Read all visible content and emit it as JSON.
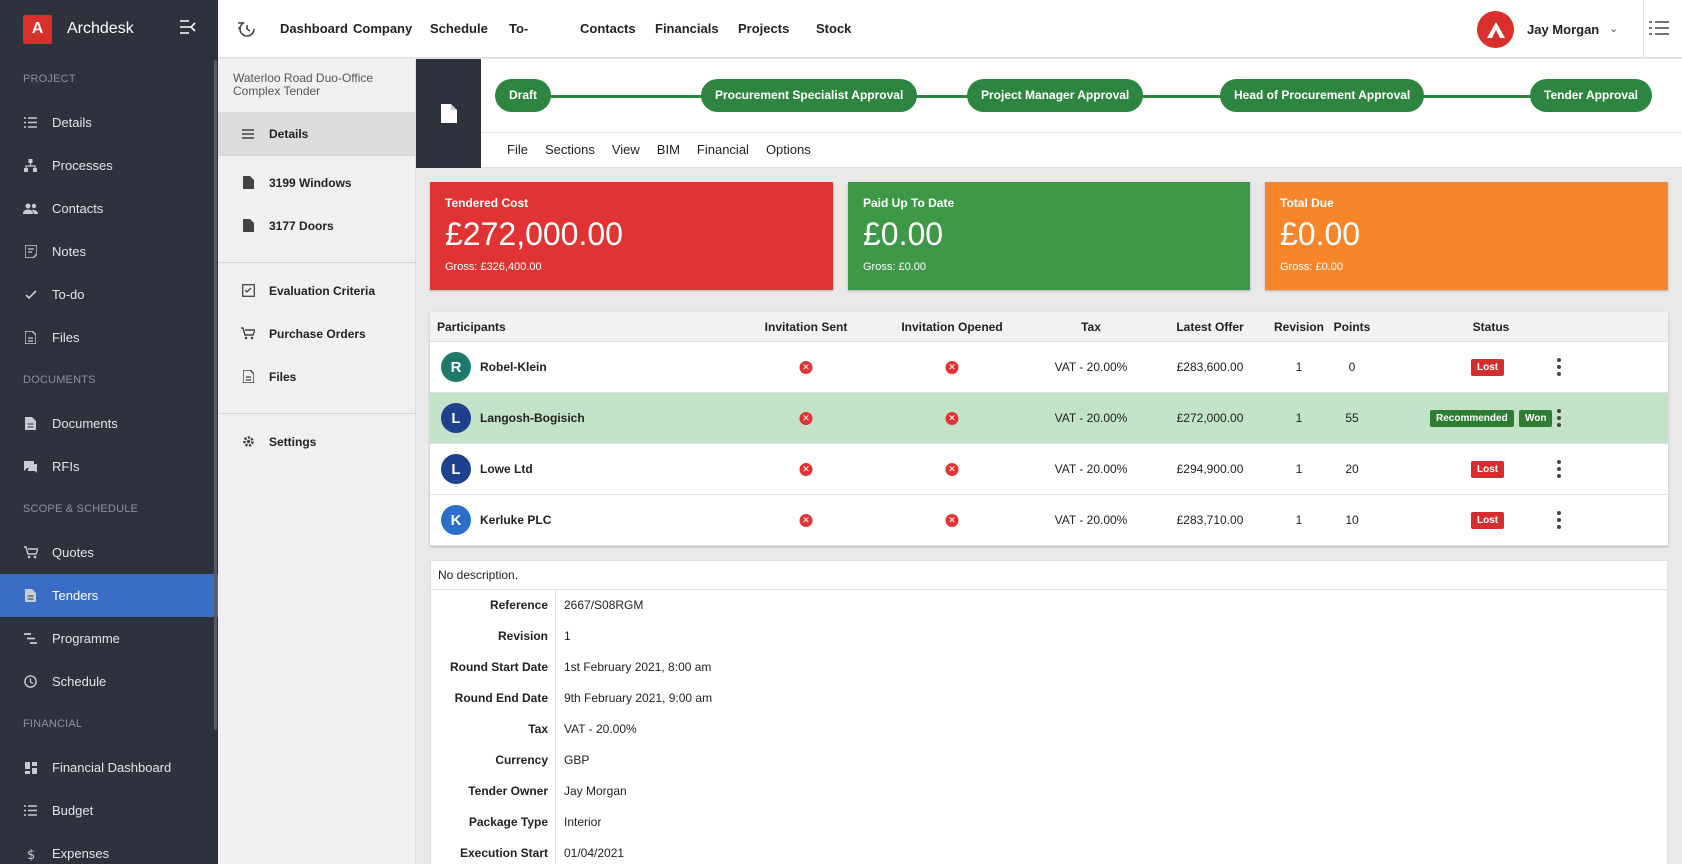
{
  "app": {
    "logo_letter": "A",
    "name": "Archdesk"
  },
  "sidebar": {
    "sections": [
      {
        "label": "PROJECT",
        "items": [
          {
            "label": "Details",
            "icon": "list-icon"
          },
          {
            "label": "Processes",
            "icon": "hierarchy-icon"
          },
          {
            "label": "Contacts",
            "icon": "people-icon"
          },
          {
            "label": "Notes",
            "icon": "note-icon"
          },
          {
            "label": "To-do",
            "icon": "check-icon"
          },
          {
            "label": "Files",
            "icon": "file-icon"
          }
        ]
      },
      {
        "label": "DOCUMENTS",
        "items": [
          {
            "label": "Documents",
            "icon": "document-icon"
          },
          {
            "label": "RFIs",
            "icon": "chat-icon"
          }
        ]
      },
      {
        "label": "SCOPE & SCHEDULE",
        "items": [
          {
            "label": "Quotes",
            "icon": "cart-icon"
          },
          {
            "label": "Tenders",
            "icon": "document-icon",
            "active": true
          },
          {
            "label": "Programme",
            "icon": "gantt-icon"
          },
          {
            "label": "Schedule",
            "icon": "clock-icon"
          }
        ]
      },
      {
        "label": "FINANCIAL",
        "items": [
          {
            "label": "Financial Dashboard",
            "icon": "dashboard-icon"
          },
          {
            "label": "Budget",
            "icon": "list-icon"
          },
          {
            "label": "Expenses",
            "icon": "dollar-icon"
          }
        ]
      }
    ]
  },
  "topnav": {
    "items": [
      "Dashboard",
      "Company",
      "Schedule",
      "To-do",
      "Contacts",
      "Financials",
      "Projects",
      "Stock"
    ],
    "user_name": "Jay Morgan"
  },
  "subnav": {
    "title": "Waterloo Road Duo-Office Complex Tender",
    "details": "Details",
    "packages": [
      "3199 Windows",
      "3177 Doors"
    ],
    "tools": [
      "Evaluation Criteria",
      "Purchase Orders",
      "Files"
    ],
    "settings": "Settings"
  },
  "workflow": {
    "steps": [
      "Draft",
      "Procurement Specialist Approval",
      "Project Manager Approval",
      "Head of Procurement Approval",
      "Tender Approval"
    ]
  },
  "menubar": {
    "items": [
      "File",
      "Sections",
      "View",
      "BIM",
      "Financial",
      "Options"
    ]
  },
  "cards": [
    {
      "label": "Tendered Cost",
      "value": "£272,000.00",
      "gross": "Gross: £326,400.00",
      "color": "#e03434"
    },
    {
      "label": "Paid Up To Date",
      "value": "£0.00",
      "gross": "Gross: £0.00",
      "color": "#3e9847"
    },
    {
      "label": "Total Due",
      "value": "£0.00",
      "gross": "Gross: £0.00",
      "color": "#f7862a"
    }
  ],
  "participants": {
    "headers": {
      "participants": "Participants",
      "invitation_sent": "Invitation Sent",
      "invitation_opened": "Invitation Opened",
      "tax": "Tax",
      "latest_offer": "Latest Offer",
      "revision": "Revision",
      "points": "Points",
      "status": "Status"
    },
    "rows": [
      {
        "initial": "R",
        "avatar_color": "#1e7a6d",
        "name": "Robel-Klein",
        "tax": "VAT - 20.00%",
        "offer": "£283,600.00",
        "revision": "1",
        "points": "0",
        "recommended": "",
        "status": "Lost"
      },
      {
        "initial": "L",
        "avatar_color": "#1f3f8f",
        "name": "Langosh-Bogisich",
        "tax": "VAT - 20.00%",
        "offer": "£272,000.00",
        "revision": "1",
        "points": "55",
        "recommended": "Recommended",
        "status": "Won"
      },
      {
        "initial": "L",
        "avatar_color": "#1f3f8f",
        "name": "Lowe Ltd",
        "tax": "VAT - 20.00%",
        "offer": "£294,900.00",
        "revision": "1",
        "points": "20",
        "recommended": "",
        "status": "Lost"
      },
      {
        "initial": "K",
        "avatar_color": "#2a6fc9",
        "name": "Kerluke PLC",
        "tax": "VAT - 20.00%",
        "offer": "£283,710.00",
        "revision": "1",
        "points": "10",
        "recommended": "",
        "status": "Lost"
      }
    ]
  },
  "details": {
    "description": "No description.",
    "fields": [
      {
        "key": "Reference",
        "value": "2667/S08RGM"
      },
      {
        "key": "Revision",
        "value": "1"
      },
      {
        "key": "Round Start Date",
        "value": "1st February 2021, 8:00 am"
      },
      {
        "key": "Round End Date",
        "value": "9th February 2021, 9:00 am"
      },
      {
        "key": "Tax",
        "value": "VAT - 20.00%"
      },
      {
        "key": "Currency",
        "value": "GBP"
      },
      {
        "key": "Tender Owner",
        "value": "Jay Morgan"
      },
      {
        "key": "Package Type",
        "value": "Interior"
      },
      {
        "key": "Execution Start",
        "value": "01/04/2021"
      }
    ]
  }
}
